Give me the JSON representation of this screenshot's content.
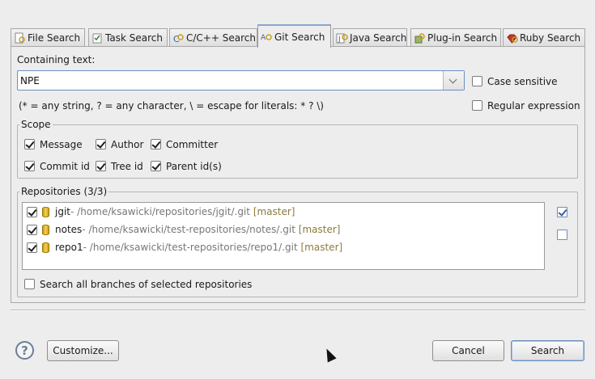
{
  "tabs": [
    {
      "label": "File Search",
      "icon": "file-search-icon"
    },
    {
      "label": "Task Search",
      "icon": "task-search-icon"
    },
    {
      "label": "C/C++ Search",
      "icon": "cpp-search-icon"
    },
    {
      "label": "Git Search",
      "icon": "git-search-icon",
      "active": true
    },
    {
      "label": "Java Search",
      "icon": "java-search-icon"
    },
    {
      "label": "Plug-in Search",
      "icon": "plugin-search-icon"
    },
    {
      "label": "Ruby Search",
      "icon": "ruby-search-icon"
    }
  ],
  "containing": {
    "label": "Containing text:",
    "value": "NPE",
    "hint": "(* = any string, ? = any character, \\ = escape for literals: * ? \\)",
    "case_sensitive": {
      "label": "Case sensitive",
      "checked": false
    },
    "regex": {
      "label": "Regular expression",
      "checked": false
    }
  },
  "scope": {
    "title": "Scope",
    "items": [
      {
        "label": "Message",
        "checked": true
      },
      {
        "label": "Author",
        "checked": true
      },
      {
        "label": "Committer",
        "checked": true
      },
      {
        "label": "Commit id",
        "checked": true
      },
      {
        "label": "Tree id",
        "checked": true
      },
      {
        "label": "Parent id(s)",
        "checked": true
      }
    ]
  },
  "repositories": {
    "title": "Repositories (3/3)",
    "items": [
      {
        "name": "jgit",
        "path": " - /home/ksawicki/repositories/jgit/.git",
        "branch": "[master]",
        "checked": true
      },
      {
        "name": "notes",
        "path": " - /home/ksawicki/test-repositories/notes/.git",
        "branch": "[master]",
        "checked": true
      },
      {
        "name": "repo1",
        "path": " - /home/ksawicki/test-repositories/repo1/.git",
        "branch": "[master]",
        "checked": true
      }
    ],
    "all_branches": {
      "label": "Search all branches of selected repositories",
      "checked": false
    }
  },
  "buttons": {
    "customize": "Customize...",
    "cancel": "Cancel",
    "search": "Search"
  },
  "colors": {
    "accent": "#6d8fbf",
    "branch": "#8a7a3a",
    "path": "#777777"
  }
}
